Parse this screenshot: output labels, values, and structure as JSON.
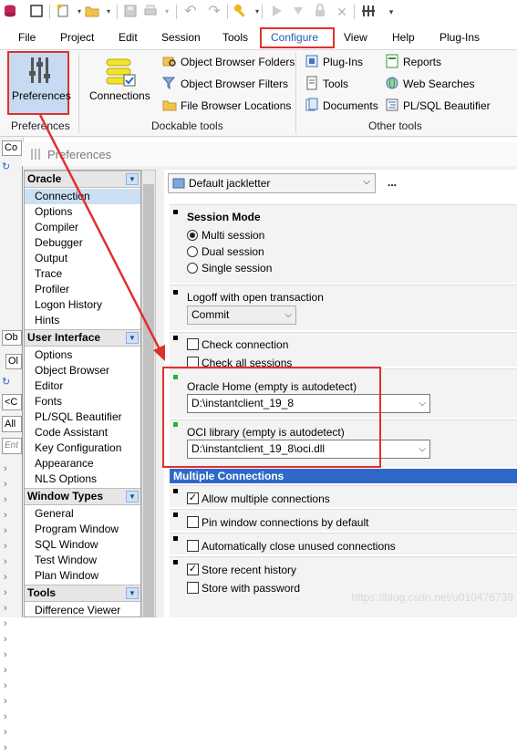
{
  "qat": {
    "icons": [
      "db-icon",
      "checkbox-icon",
      "new-icon",
      "open-folder-icon",
      "save-icon",
      "print-icon",
      "undo-icon",
      "redo-icon",
      "key-icon",
      "run-icon",
      "execute-icon",
      "lock-icon",
      "clear-icon",
      "columns-icon",
      "dropdown-icon"
    ]
  },
  "menu": {
    "file": "File",
    "project": "Project",
    "edit": "Edit",
    "session": "Session",
    "tools": "Tools",
    "configure": "Configure",
    "view": "View",
    "help": "Help",
    "plugins": "Plug-Ins"
  },
  "ribbon": {
    "preferences_btn": "Preferences",
    "connections_btn": "Connections",
    "object_browser_folders": "Object Browser Folders",
    "object_browser_filters": "Object Browser Filters",
    "file_browser_locations": "File Browser Locations",
    "plugins": "Plug-Ins",
    "tools": "Tools",
    "documents": "Documents",
    "reports": "Reports",
    "web_searches": "Web Searches",
    "plsql_beautifier": "PL/SQL Beautifier",
    "group_preferences": "Preferences",
    "group_dockable": "Dockable tools",
    "group_other": "Other tools"
  },
  "bgpane": {
    "co": "Co",
    "ob": "Ob",
    "ol": "Ol",
    "c": "<C",
    "all": "All",
    "ent": "Ent"
  },
  "dialog": {
    "title": "Preferences"
  },
  "tree": {
    "oracle": {
      "header": "Oracle",
      "items": [
        "Connection",
        "Options",
        "Compiler",
        "Debugger",
        "Output",
        "Trace",
        "Profiler",
        "Logon History",
        "Hints"
      ]
    },
    "user_interface": {
      "header": "User Interface",
      "items": [
        "Options",
        "Object Browser",
        "Editor",
        "Fonts",
        "PL/SQL Beautifier",
        "Code Assistant",
        "Key Configuration",
        "Appearance",
        "NLS Options"
      ]
    },
    "window_types": {
      "header": "Window Types",
      "items": [
        "General",
        "Program Window",
        "SQL Window",
        "Test Window",
        "Plan Window"
      ]
    },
    "tools": {
      "header": "Tools",
      "items": [
        "Difference Viewer"
      ]
    }
  },
  "settings": {
    "profile": "Default jackletter",
    "more": "...",
    "session_mode_label": "Session Mode",
    "multi_session": "Multi session",
    "dual_session": "Dual session",
    "single_session": "Single session",
    "logoff_label": "Logoff with open transaction",
    "logoff_value": "Commit",
    "check_connection": "Check connection",
    "check_all_sessions": "Check all sessions",
    "oracle_home_label": "Oracle Home (empty is autodetect)",
    "oracle_home_value": "D:\\instantclient_19_8",
    "oci_library_label": "OCI library (empty is autodetect)",
    "oci_library_value": "D:\\instantclient_19_8\\oci.dll",
    "multiple_connections_header": "Multiple Connections",
    "allow_multiple": "Allow multiple connections",
    "pin_window": "Pin window connections by default",
    "auto_close": "Automatically close unused connections",
    "store_history": "Store recent history",
    "store_password": "Store with password"
  },
  "state": {
    "session_mode": "Multi session",
    "allow_multiple": true,
    "pin_window": false,
    "auto_close": false,
    "store_history": true,
    "store_password": false,
    "check_connection": false,
    "check_all_sessions": false
  },
  "watermark": "https://blog.csdn.net/u010476739",
  "colors": {
    "highlight_red": "#e0302b",
    "selection_blue": "#cce0f4",
    "section_header_blue": "#2f68c9",
    "autodetect_green": "#22b532"
  }
}
